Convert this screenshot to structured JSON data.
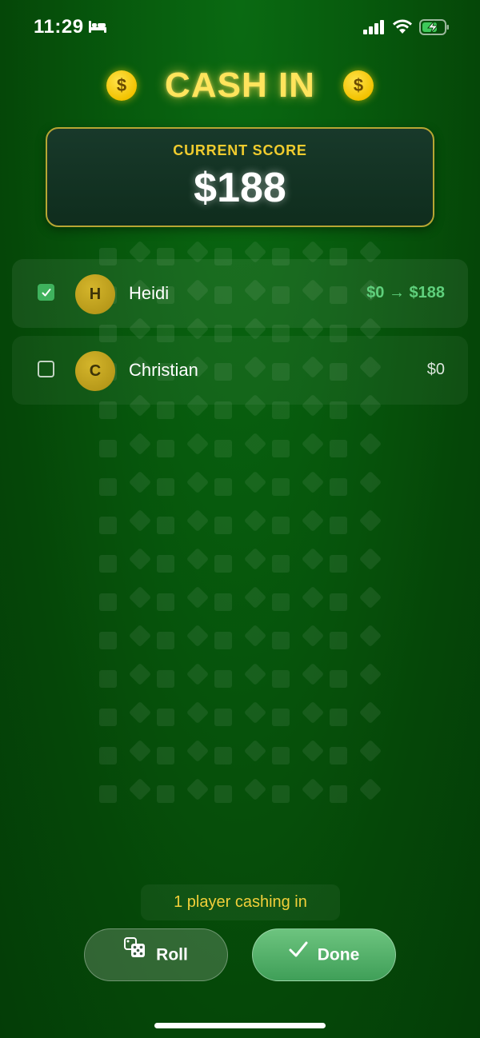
{
  "status_bar": {
    "time": "11:29",
    "icons": [
      "bed-icon",
      "signal-icon",
      "wifi-icon",
      "battery-charging-icon"
    ]
  },
  "header": {
    "title": "CASH IN",
    "coin_symbol": "$"
  },
  "score": {
    "label": "CURRENT SCORE",
    "value": "$188"
  },
  "players": [
    {
      "initial": "H",
      "name": "Heidi",
      "amount": "$0 → $188",
      "checked": true
    },
    {
      "initial": "C",
      "name": "Christian",
      "amount": "$0",
      "checked": false
    }
  ],
  "footer": {
    "status": "1 player cashing in",
    "roll_label": "Roll",
    "done_label": "Done"
  },
  "colors": {
    "background": "#054708",
    "accent_gold": "#ffe45c",
    "gain_green": "#5fd07c",
    "checkbox_green": "#3fb25d",
    "done_button": "#4fae66"
  }
}
